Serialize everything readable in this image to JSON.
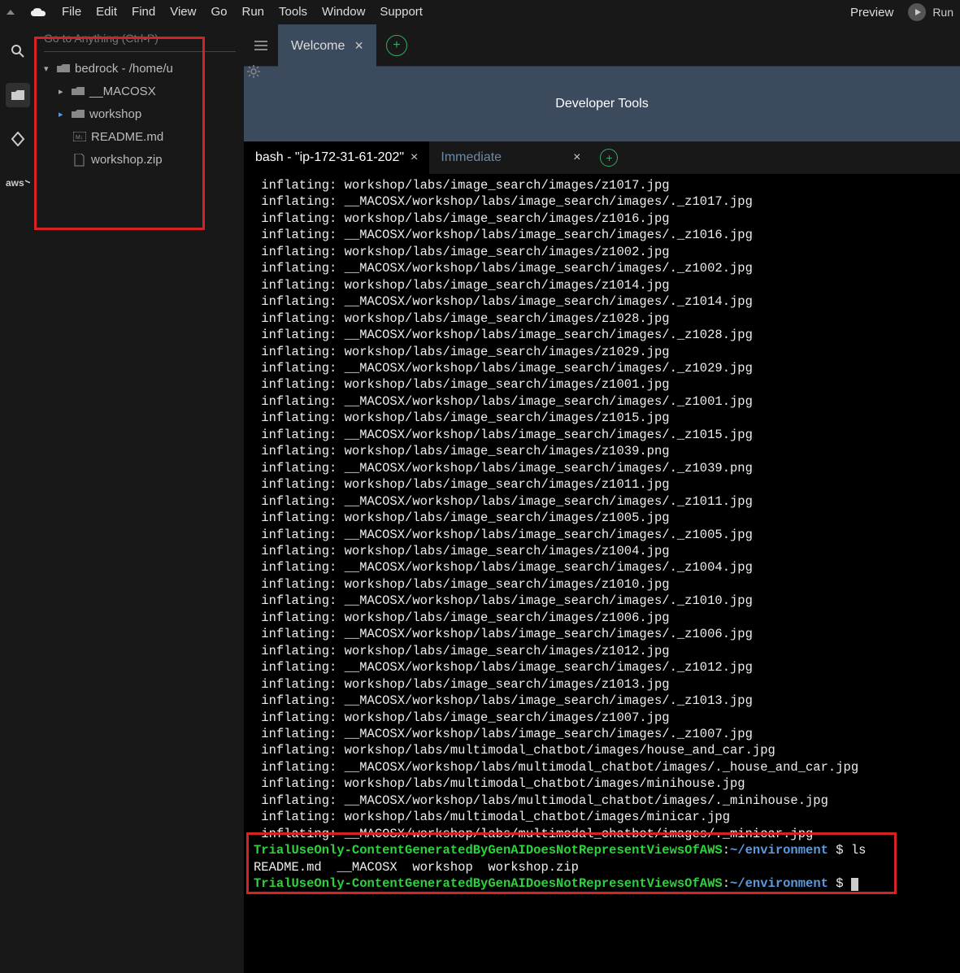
{
  "menu": {
    "items": [
      "File",
      "Edit",
      "Find",
      "View",
      "Go",
      "Run",
      "Tools",
      "Window",
      "Support"
    ],
    "preview": "Preview",
    "run": "Run"
  },
  "sidebar": {
    "search_placeholder": "Go to Anything (Ctrl-P)",
    "root": "bedrock - /home/u",
    "items": [
      {
        "label": "__MACOSX",
        "type": "folder",
        "expand": "▶"
      },
      {
        "label": "workshop",
        "type": "folder",
        "expand": "▶"
      },
      {
        "label": "README.md",
        "type": "md"
      },
      {
        "label": "workshop.zip",
        "type": "zip"
      }
    ]
  },
  "tabs": {
    "welcome": "Welcome",
    "header": "Developer Tools"
  },
  "termtabs": {
    "bash": "bash - \"ip-172-31-61-202\"",
    "immediate": "Immediate"
  },
  "terminal": {
    "lines": [
      " inflating: workshop/labs/image_search/images/z1017.jpg",
      " inflating: __MACOSX/workshop/labs/image_search/images/._z1017.jpg",
      " inflating: workshop/labs/image_search/images/z1016.jpg",
      " inflating: __MACOSX/workshop/labs/image_search/images/._z1016.jpg",
      " inflating: workshop/labs/image_search/images/z1002.jpg",
      " inflating: __MACOSX/workshop/labs/image_search/images/._z1002.jpg",
      " inflating: workshop/labs/image_search/images/z1014.jpg",
      " inflating: __MACOSX/workshop/labs/image_search/images/._z1014.jpg",
      " inflating: workshop/labs/image_search/images/z1028.jpg",
      " inflating: __MACOSX/workshop/labs/image_search/images/._z1028.jpg",
      " inflating: workshop/labs/image_search/images/z1029.jpg",
      " inflating: __MACOSX/workshop/labs/image_search/images/._z1029.jpg",
      " inflating: workshop/labs/image_search/images/z1001.jpg",
      " inflating: __MACOSX/workshop/labs/image_search/images/._z1001.jpg",
      " inflating: workshop/labs/image_search/images/z1015.jpg",
      " inflating: __MACOSX/workshop/labs/image_search/images/._z1015.jpg",
      " inflating: workshop/labs/image_search/images/z1039.png",
      " inflating: __MACOSX/workshop/labs/image_search/images/._z1039.png",
      " inflating: workshop/labs/image_search/images/z1011.jpg",
      " inflating: __MACOSX/workshop/labs/image_search/images/._z1011.jpg",
      " inflating: workshop/labs/image_search/images/z1005.jpg",
      " inflating: __MACOSX/workshop/labs/image_search/images/._z1005.jpg",
      " inflating: workshop/labs/image_search/images/z1004.jpg",
      " inflating: __MACOSX/workshop/labs/image_search/images/._z1004.jpg",
      " inflating: workshop/labs/image_search/images/z1010.jpg",
      " inflating: __MACOSX/workshop/labs/image_search/images/._z1010.jpg",
      " inflating: workshop/labs/image_search/images/z1006.jpg",
      " inflating: __MACOSX/workshop/labs/image_search/images/._z1006.jpg",
      " inflating: workshop/labs/image_search/images/z1012.jpg",
      " inflating: __MACOSX/workshop/labs/image_search/images/._z1012.jpg",
      " inflating: workshop/labs/image_search/images/z1013.jpg",
      " inflating: __MACOSX/workshop/labs/image_search/images/._z1013.jpg",
      " inflating: workshop/labs/image_search/images/z1007.jpg",
      " inflating: __MACOSX/workshop/labs/image_search/images/._z1007.jpg",
      " inflating: workshop/labs/multimodal_chatbot/images/house_and_car.jpg",
      " inflating: __MACOSX/workshop/labs/multimodal_chatbot/images/._house_and_car.jpg",
      " inflating: workshop/labs/multimodal_chatbot/images/minihouse.jpg",
      " inflating: __MACOSX/workshop/labs/multimodal_chatbot/images/._minihouse.jpg",
      " inflating: workshop/labs/multimodal_chatbot/images/minicar.jpg",
      " inflating: __MACOSX/workshop/labs/multimodal_chatbot/images/._minicar.jpg"
    ],
    "prompt_user": "TrialUseOnly-ContentGeneratedByGenAIDoesNotRepresentViewsOfAWS",
    "prompt_path": "~/environment",
    "cmd1": "ls",
    "ls_output": "README.md  __MACOSX  workshop  workshop.zip"
  }
}
